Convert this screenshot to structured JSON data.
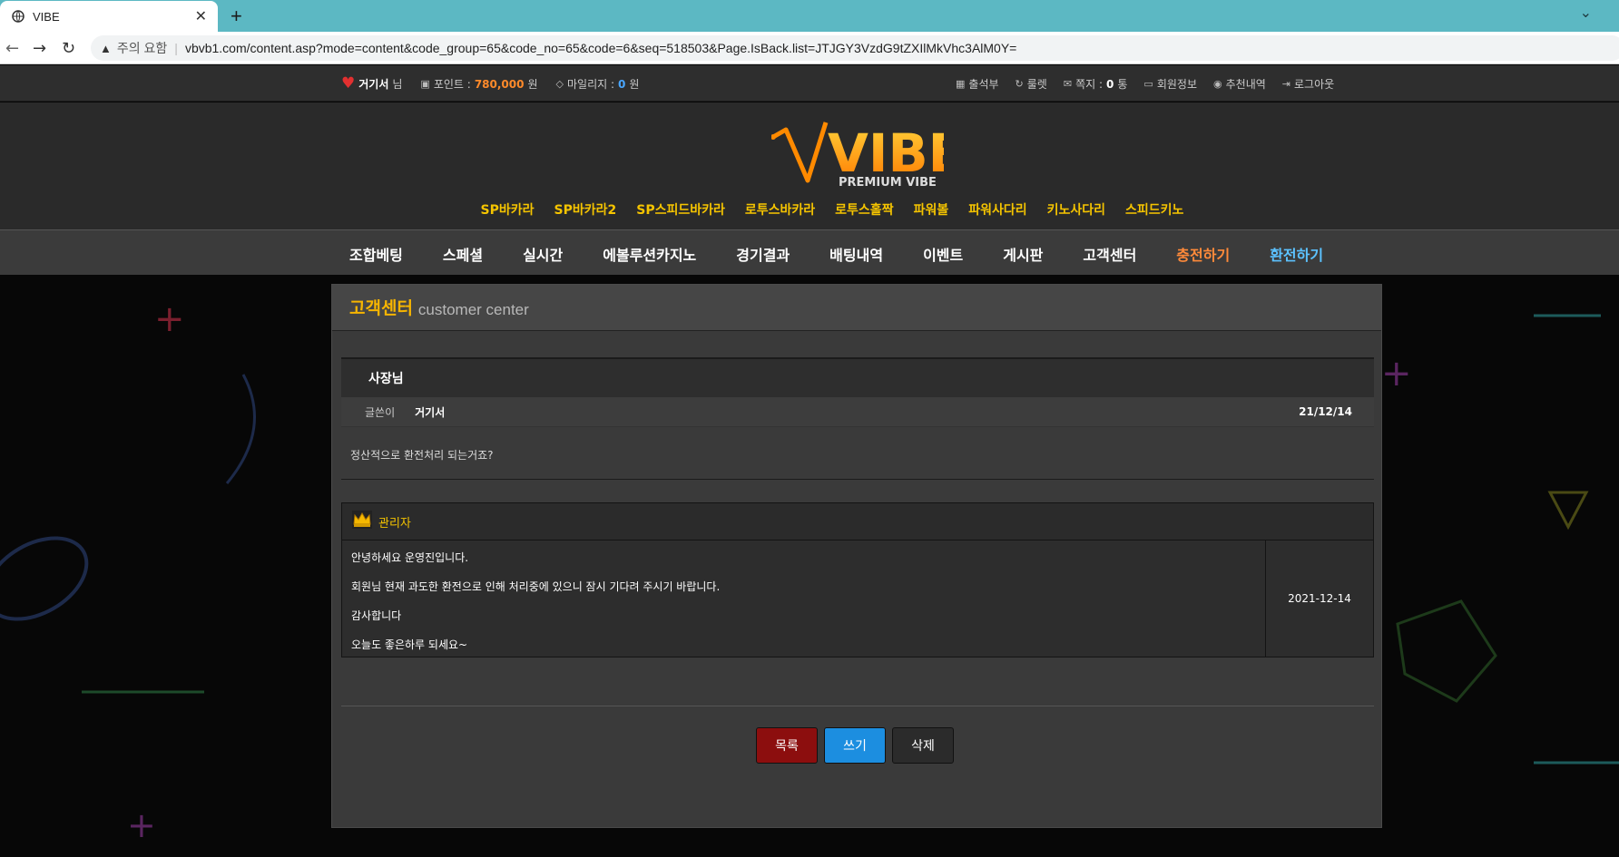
{
  "browser": {
    "tab_title": "VIBE",
    "new_tab": "+",
    "security_label": "주의 요함",
    "url": "vbvb1.com/content.asp?mode=content&code_group=65&code_no=65&code=6&seq=518503&Page.IsBack.list=JTJGY3VzdG9tZXIlMkVhc3AlM0Y="
  },
  "topbar": {
    "username": "거기서",
    "username_suffix": "님",
    "points_label": "포인트 :",
    "points_value": "780,000",
    "points_unit": "원",
    "mileage_label": "마일리지 :",
    "mileage_value": "0",
    "mileage_unit": "원",
    "attendance": "출석부",
    "roulette": "룰렛",
    "message_label": "쪽지 :",
    "message_count": "0",
    "message_unit": "통",
    "member_info": "회원정보",
    "referral": "추천내역",
    "logout": "로그아웃"
  },
  "logo": {
    "text": "VIBE",
    "subtitle": "PREMIUM VIBE"
  },
  "game_nav": [
    "SP바카라",
    "SP바카라2",
    "SP스피드바카라",
    "로투스바카라",
    "로투스홀짝",
    "파워볼",
    "파워사다리",
    "키노사다리",
    "스피드키노"
  ],
  "main_nav": {
    "items": [
      "조합베팅",
      "스페셜",
      "실시간",
      "에볼루션카지노",
      "경기결과",
      "배팅내역",
      "이벤트",
      "게시판",
      "고객센터"
    ],
    "charge": "충전하기",
    "exchange": "환전하기"
  },
  "panel": {
    "title_ko": "고객센터",
    "title_en": "customer center"
  },
  "post": {
    "title": "사장님",
    "writer_label": "글쓴이",
    "writer": "거기서",
    "date": "21/12/14",
    "body": "정산적으로 환전처리 되는거죠?"
  },
  "reply": {
    "author": "관리자",
    "lines": [
      "안녕하세요 운영진입니다.",
      "회원님 현재 과도한 환전으로 인해 처리중에 있으니 잠시 기다려 주시기 바랍니다.",
      "감사합니다",
      "오늘도 좋은하루 되세요~"
    ],
    "date": "2021-12-14"
  },
  "buttons": {
    "list": "목록",
    "write": "쓰기",
    "delete": "삭제"
  },
  "colors": {
    "gold": "#f5c400",
    "orange": "#ff8a2a",
    "blue": "#49a6ff",
    "list_button": "#8c0e0e",
    "write_button": "#1c8ee0"
  }
}
